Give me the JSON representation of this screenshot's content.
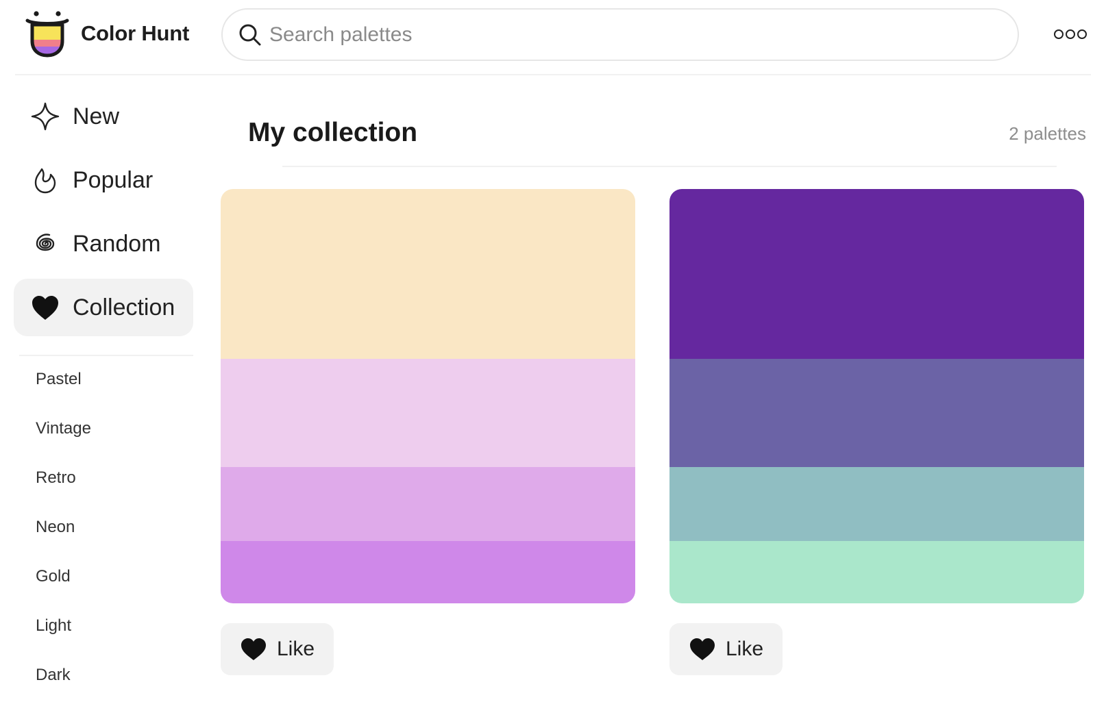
{
  "header": {
    "logo_text": "Color Hunt",
    "search_placeholder": "Search palettes"
  },
  "sidebar": {
    "nav": [
      {
        "label": "New",
        "icon": "sparkle-icon"
      },
      {
        "label": "Popular",
        "icon": "flame-icon"
      },
      {
        "label": "Random",
        "icon": "spiral-icon"
      },
      {
        "label": "Collection",
        "icon": "heart-icon",
        "active": true
      }
    ],
    "tags": [
      "Pastel",
      "Vintage",
      "Retro",
      "Neon",
      "Gold",
      "Light",
      "Dark"
    ]
  },
  "main": {
    "title": "My collection",
    "count": "2 palettes",
    "palettes": [
      {
        "colors": [
          "#fae7c5",
          "#eecdee",
          "#dfaaea",
          "#cf88e9"
        ],
        "like_label": "Like"
      },
      {
        "colors": [
          "#65289f",
          "#6b63a6",
          "#90bec2",
          "#aae7cb"
        ],
        "like_label": "Like"
      }
    ]
  },
  "colors": {
    "logo_yellow": "#f7e35a",
    "logo_pink": "#f07f8b",
    "logo_purple": "#a668e3",
    "active_nav_bg": "#f2f2f2",
    "like_button_bg": "#f2f2f2"
  }
}
